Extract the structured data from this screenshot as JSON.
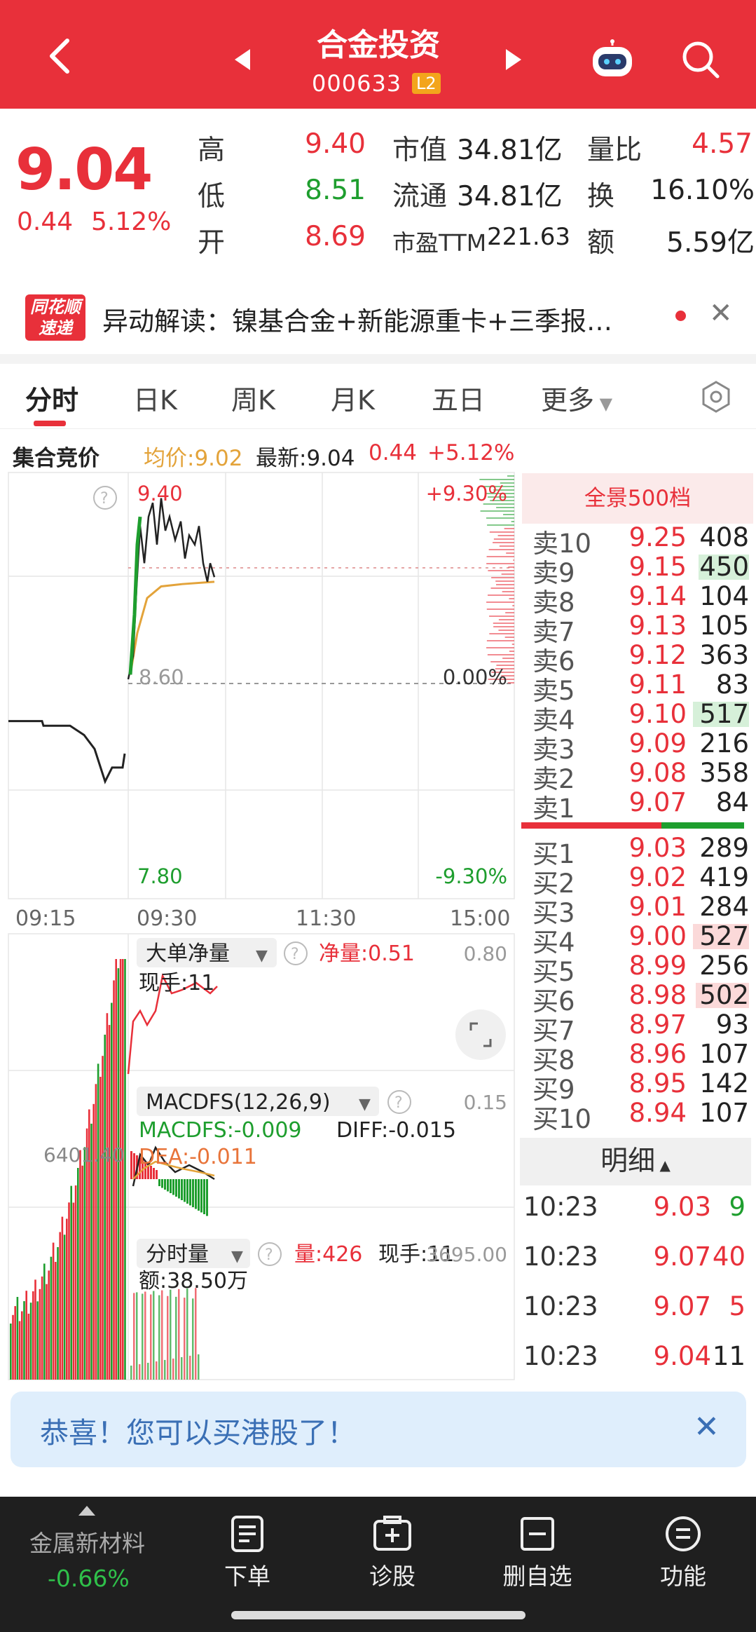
{
  "header": {
    "title": "合金投资",
    "code": "000633",
    "badge": "L2"
  },
  "quote": {
    "price": "9.04",
    "change": "0.44",
    "change_pct": "5.12%",
    "labels": {
      "high": "高",
      "low": "低",
      "open": "开",
      "mcap": "市值",
      "float": "流通",
      "pe": "市盈TTM",
      "vol_ratio": "量比",
      "turnover": "换",
      "amount": "额"
    },
    "high": "9.40",
    "low": "8.51",
    "open": "8.69",
    "mcap": "34.81亿",
    "float": "34.81亿",
    "pe": "221.63",
    "vol_ratio": "4.57",
    "turnover": "16.10%",
    "amount": "5.59亿"
  },
  "news": {
    "logo_line1": "同花顺",
    "logo_line2": "速递",
    "text": "异动解读：镍基合金+新能源重卡+三季报…"
  },
  "tabs": [
    "分时",
    "日K",
    "周K",
    "月K",
    "五日",
    "更多"
  ],
  "info": {
    "auction": "集合竞价",
    "avg": "均价:9.02",
    "latest": "最新:9.04",
    "chg": "0.44",
    "pct": "+5.12%"
  },
  "chart": {
    "y_top": "9.40",
    "y_mid": "8.60",
    "y_bot": "7.80",
    "pct_top": "+9.30%",
    "pct_mid": "0.00%",
    "pct_bot": "-9.30%",
    "times": [
      "09:15",
      "09:30",
      "11:30",
      "15:00"
    ],
    "ind1_name": "大单净量",
    "ind1_net": "净量:0.51",
    "ind1_val": "0.80",
    "ind1_hand": "现手:11",
    "ind2_name": "MACDFS(12,26,9)",
    "ind2_val": "0.15",
    "macdfs": "MACDFS:-0.009",
    "diff": "DIFF:-0.015",
    "dea": "DEA:-0.011",
    "left_val": "6401.40",
    "ind3_name": "分时量",
    "ind3_vol": "量:426",
    "ind3_hand": "现手:11",
    "ind3_val": "3695.00",
    "ind3_amt": "额:38.50万"
  },
  "chart_data": {
    "type": "line",
    "price_series": [
      {
        "t": "09:15",
        "v": 8.42
      },
      {
        "t": "09:20",
        "v": 8.4
      },
      {
        "t": "09:25",
        "v": 8.22
      },
      {
        "t": "09:30",
        "v": 8.6
      },
      {
        "t": "09:35",
        "v": 9.25
      },
      {
        "t": "09:45",
        "v": 9.38
      },
      {
        "t": "10:00",
        "v": 9.22
      },
      {
        "t": "10:15",
        "v": 9.18
      },
      {
        "t": "10:23",
        "v": 9.04
      }
    ],
    "avg_series": [
      {
        "t": "09:30",
        "v": 8.6
      },
      {
        "t": "09:45",
        "v": 8.95
      },
      {
        "t": "10:00",
        "v": 9.0
      },
      {
        "t": "10:23",
        "v": 9.02
      }
    ],
    "ylim": [
      7.8,
      9.4
    ]
  },
  "orderbook": {
    "header": "全景500档",
    "sells": [
      {
        "n": "卖10",
        "p": "9.25",
        "v": "408",
        "w": 0
      },
      {
        "n": "卖9",
        "p": "9.15",
        "v": "450",
        "w": 0.9
      },
      {
        "n": "卖8",
        "p": "9.14",
        "v": "104",
        "w": 0
      },
      {
        "n": "卖7",
        "p": "9.13",
        "v": "105",
        "w": 0
      },
      {
        "n": "卖6",
        "p": "9.12",
        "v": "363",
        "w": 0
      },
      {
        "n": "卖5",
        "p": "9.11",
        "v": "83",
        "w": 0
      },
      {
        "n": "卖4",
        "p": "9.10",
        "v": "517",
        "w": 1
      },
      {
        "n": "卖3",
        "p": "9.09",
        "v": "216",
        "w": 0
      },
      {
        "n": "卖2",
        "p": "9.08",
        "v": "358",
        "w": 0
      },
      {
        "n": "卖1",
        "p": "9.07",
        "v": "84",
        "w": 0
      }
    ],
    "buys": [
      {
        "n": "买1",
        "p": "9.03",
        "v": "289",
        "w": 0
      },
      {
        "n": "买2",
        "p": "9.02",
        "v": "419",
        "w": 0
      },
      {
        "n": "买3",
        "p": "9.01",
        "v": "284",
        "w": 0
      },
      {
        "n": "买4",
        "p": "9.00",
        "v": "527",
        "w": 1
      },
      {
        "n": "买5",
        "p": "8.99",
        "v": "256",
        "w": 0
      },
      {
        "n": "买6",
        "p": "8.98",
        "v": "502",
        "w": 0.95
      },
      {
        "n": "买7",
        "p": "8.97",
        "v": "93",
        "w": 0
      },
      {
        "n": "买8",
        "p": "8.96",
        "v": "107",
        "w": 0
      },
      {
        "n": "买9",
        "p": "8.95",
        "v": "142",
        "w": 0
      },
      {
        "n": "买10",
        "p": "8.94",
        "v": "107",
        "w": 0
      }
    ]
  },
  "detail": {
    "header": "明细",
    "rows": [
      {
        "t": "10:23",
        "p": "9.03",
        "v": "9",
        "c": "grn"
      },
      {
        "t": "10:23",
        "p": "9.07",
        "v": "40",
        "c": "red"
      },
      {
        "t": "10:23",
        "p": "9.07",
        "v": "5",
        "c": "red"
      },
      {
        "t": "10:23",
        "p": "9.04",
        "v": "11",
        "c": "dark"
      }
    ]
  },
  "banner": {
    "text": "恭喜！您可以买港股了！"
  },
  "bottom": {
    "sector": "金属新材料",
    "sector_chg": "-0.66%",
    "buttons": [
      "下单",
      "诊股",
      "删自选",
      "功能"
    ]
  },
  "colors": {
    "red": "#e8303a",
    "green": "#1e9e2e",
    "avg_line": "#e3a33a"
  }
}
